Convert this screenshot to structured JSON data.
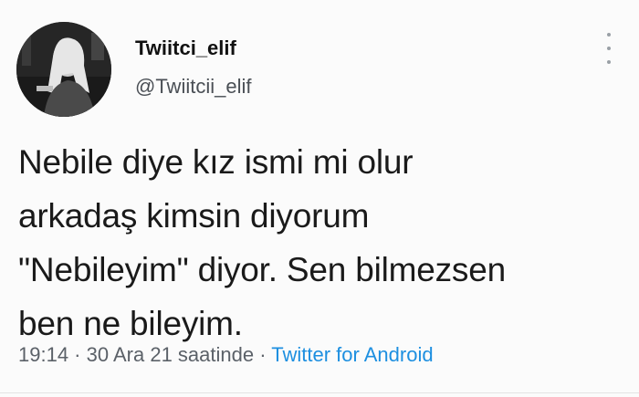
{
  "user": {
    "display_name": "Twiitci_elif",
    "handle": "@Twiitcii_elif"
  },
  "tweet": {
    "lines": [
      "Nebile diye kız ismi mi olur",
      "arkadaş kimsin diyorum",
      "\"Nebileyim\" diyor. Sen bilmezsen",
      "ben ne bileyim."
    ]
  },
  "meta": {
    "time": "19:14",
    "sep1": " · ",
    "date": "30 Ara 21 saatinde",
    "sep2": " · ",
    "source": "Twitter for Android"
  },
  "icons": {
    "more": "more-vertical-icon"
  },
  "colors": {
    "link": "#1d8fe0",
    "text": "#1a1a1a",
    "muted": "#5b6168"
  }
}
